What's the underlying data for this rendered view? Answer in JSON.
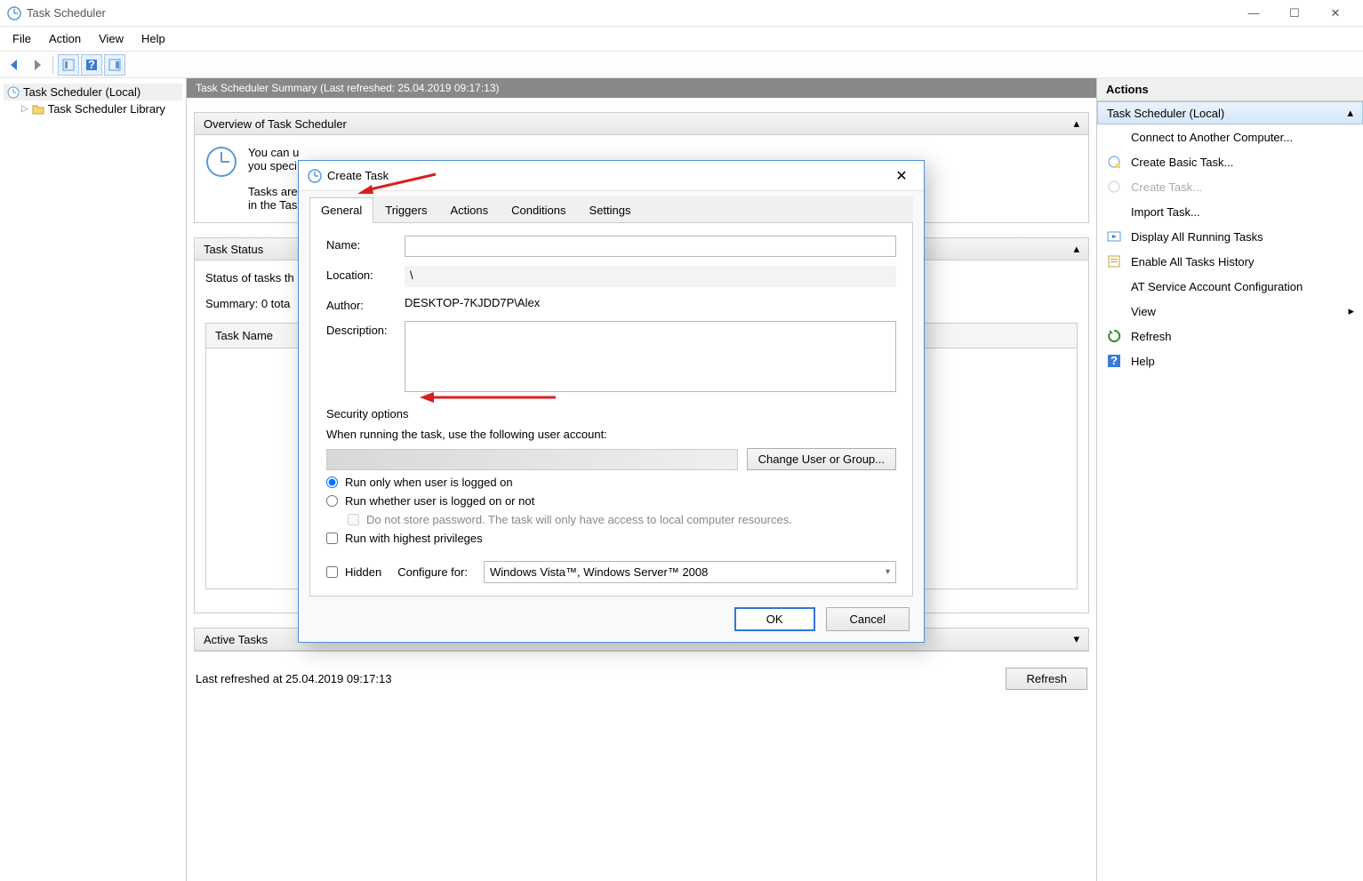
{
  "window": {
    "title": "Task Scheduler"
  },
  "menu": {
    "file": "File",
    "action": "Action",
    "view": "View",
    "help": "Help"
  },
  "tree": {
    "root": "Task Scheduler (Local)",
    "library": "Task Scheduler Library"
  },
  "summary_header": "Task Scheduler Summary (Last refreshed: 25.04.2019 09:17:13)",
  "overview": {
    "title": "Overview of Task Scheduler",
    "line1": "You can u",
    "line2": "you speci",
    "line3": "Tasks are",
    "line4": "in the Tas"
  },
  "task_status": {
    "title": "Task Status",
    "status_line": "Status of tasks th",
    "summary_line": "Summary: 0 tota",
    "col_name": "Task Name"
  },
  "active_tasks": {
    "title": "Active Tasks"
  },
  "bottom": {
    "last_refreshed": "Last refreshed at 25.04.2019 09:17:13",
    "refresh": "Refresh"
  },
  "actions": {
    "header": "Actions",
    "context": "Task Scheduler (Local)",
    "items": {
      "connect": "Connect to Another Computer...",
      "create_basic": "Create Basic Task...",
      "create_task": "Create Task...",
      "import": "Import Task...",
      "display_running": "Display All Running Tasks",
      "enable_history": "Enable All Tasks History",
      "at_service": "AT Service Account Configuration",
      "view": "View",
      "refresh": "Refresh",
      "help": "Help"
    }
  },
  "dialog": {
    "title": "Create Task",
    "tabs": {
      "general": "General",
      "triggers": "Triggers",
      "actions": "Actions",
      "conditions": "Conditions",
      "settings": "Settings"
    },
    "name_label": "Name:",
    "name_value": "",
    "location_label": "Location:",
    "location_value": "\\",
    "author_label": "Author:",
    "author_value": "DESKTOP-7KJDD7P\\Alex",
    "description_label": "Description:",
    "description_value": "",
    "security_label": "Security options",
    "when_running": "When running the task, use the following user account:",
    "change_user": "Change User or Group...",
    "run_logged_on": "Run only when user is logged on",
    "run_whether": "Run whether user is logged on or not",
    "do_not_store": "Do not store password.  The task will only have access to local computer resources.",
    "highest_priv": "Run with highest privileges",
    "hidden": "Hidden",
    "configure_for": "Configure for:",
    "configure_value": "Windows Vista™, Windows Server™ 2008",
    "ok": "OK",
    "cancel": "Cancel"
  }
}
